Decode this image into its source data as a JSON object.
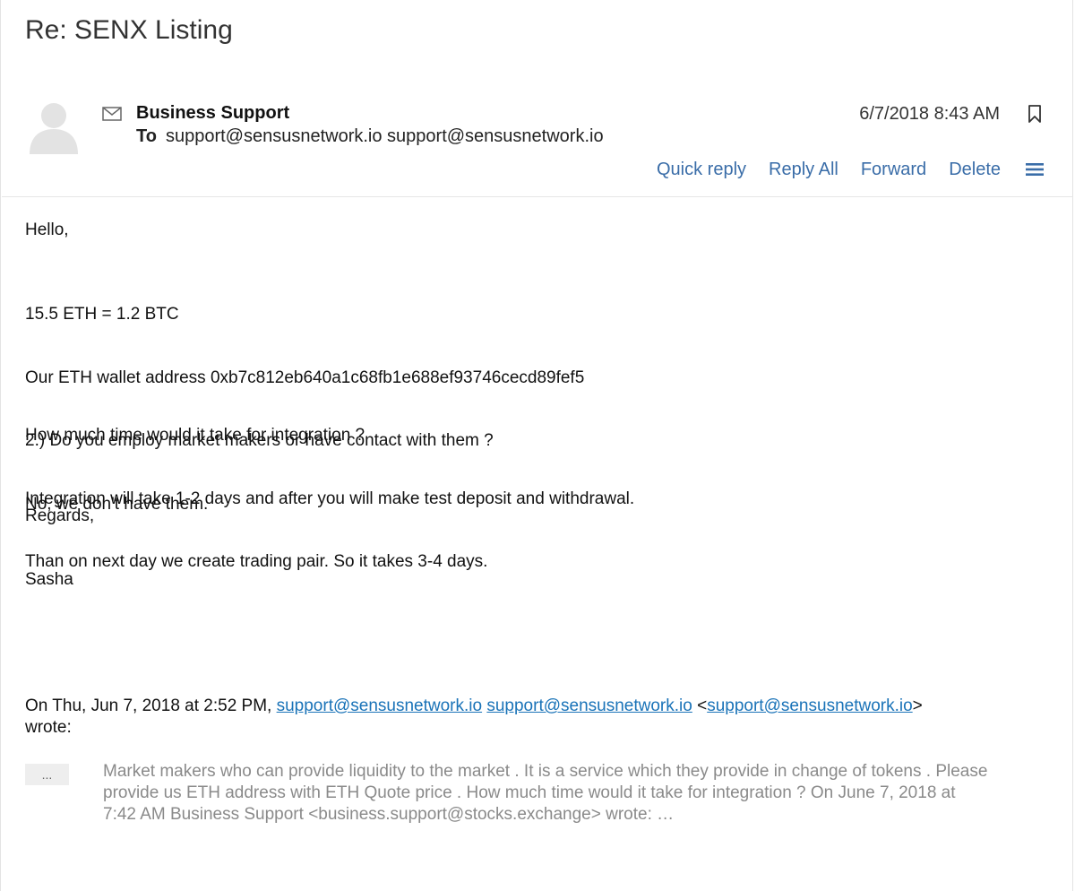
{
  "email": {
    "subject": "Re: SENX Listing",
    "sender_name": "Business Support",
    "to_label": "To",
    "to_value": "support@sensusnetwork.io support@sensusnetwork.io",
    "date": "6/7/2018 8:43 AM"
  },
  "actions": {
    "quick_reply": "Quick reply",
    "reply_all": "Reply All",
    "forward": "Forward",
    "delete": "Delete"
  },
  "body": {
    "greeting": "Hello,",
    "lines": [
      "15.5 ETH = 1.2 BTC",
      "Our ETH wallet address 0xb7c812eb640a1c68fb1e688ef93746cecd89fef5",
      "2.) Do you employ market makers or have contact with them ?",
      "No, we don't have them."
    ],
    "lines2": [
      "How much time would it take for integration ?",
      "Integration will take 1-2 days and after you will make test deposit and withdrawal.",
      "Than on next day we create trading pair. So it takes 3-4 days."
    ],
    "closing": "Regards,",
    "signature": "Sasha"
  },
  "quote": {
    "prefix": "On Thu, Jun 7, 2018 at 2:52 PM, ",
    "link1": "support@sensusnetwork.io",
    "link2": "support@sensusnetwork.io",
    "open_bracket": " <",
    "link3": "support@sensusnetwork.io",
    "close_bracket": ">",
    "suffix": "wrote:",
    "ellipsis_label": "...",
    "quoted_text": "Market makers who can provide liquidity to the market . It is a service which they provide in change of tokens . Please provide us ETH address with ETH Quote price . How much time would it take for integration ? On June 7, 2018 at 7:42 AM Business Support <business.support@stocks.exchange> wrote: …"
  },
  "colors": {
    "link": "#3a6da8",
    "quote_link": "#1a73b8",
    "quoted_text": "#8a8a8a"
  },
  "icons": {
    "avatar": "user-avatar-icon",
    "envelope": "envelope-icon",
    "bookmark": "bookmark-icon",
    "menu": "hamburger-menu-icon"
  }
}
